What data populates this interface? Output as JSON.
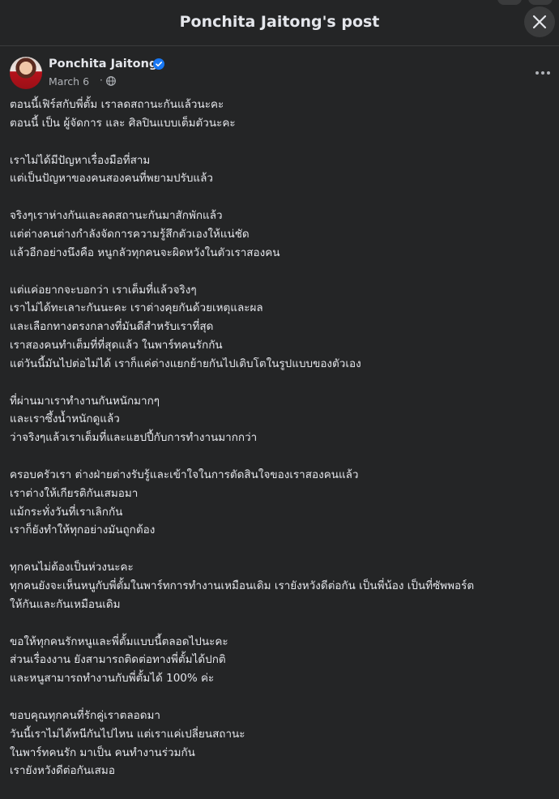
{
  "modal": {
    "title": "Ponchita Jaitong's post"
  },
  "post": {
    "author": "Ponchita Jaitong",
    "date": "March 6",
    "separator": "·",
    "verified_color": "#1877f2",
    "paragraphs": [
      [
        "ตอนนี้เฟิร์สกับพี่ตั้ม เราลดสถานะกันแล้วนะคะ",
        "ตอนนี้ เป็น ผู้จัดการ และ ศิลปินแบบเต็มตัวนะคะ"
      ],
      [
        "เราไม่ได้มีปัญหาเรื่องมือที่สาม",
        "แต่เป็นปัญหาของคนสองคนที่พยามปรับแล้ว"
      ],
      [
        "จริงๆเราห่างกันและลดสถานะกันมาสักพักแล้ว",
        "แต่ต่างคนต่างกำลังจัดการความรู้สึกตัวเองให้แน่ชัด",
        "แล้วอีกอย่างนึงคือ หนูกลัวทุกคนจะผิดหวังในตัวเราสองคน"
      ],
      [
        "แต่แค่อยากจะบอกว่า เราเต็มที่แล้วจริงๆ",
        "เราไม่ได้ทะเลาะกันนะคะ เราต่างคุยกันด้วยเหตุและผล",
        "และเลือกทางตรงกลางที่มันดีสำหรับเราที่สุด",
        "เราสองคนทำเต็มที่ที่สุดแล้ว ในพาร์ทคนรักกัน",
        "แต่วันนี้มันไปต่อไม่ได้ เราก็แค่ต่างแยกย้ายกันไปเติบโตในรูปแบบของตัวเอง"
      ],
      [
        "ที่ผ่านมาเราทำงานกันหนักมากๆ",
        "และเราซึ้งน้ำหนักดูแล้ว",
        "ว่าจริงๆแล้วเราเต็มที่และแฮปปี้กับการทำงานมากกว่า"
      ],
      [
        "ครอบครัวเรา ต่างฝ่ายต่างรับรู้และเข้าใจในการตัดสินใจของเราสองคนแล้ว",
        "เราต่างให้เกียรติกันเสมอมา",
        "แม้กระทั่งวันที่เราเลิกกัน",
        "เราก็ยังทำให้ทุกอย่างมันถูกต้อง"
      ],
      [
        "ทุกคนไม่ต้องเป็นห่วงนะคะ",
        "ทุกคนยังจะเห็นหนูกับพี่ตั้มในพาร์ทการทำงานเหมือนเดิม เรายังหวังดีต่อกัน เป็นพี่น้อง เป็นที่ซัพพอร์ต",
        "ให้กันและกันเหมือนเดิม"
      ],
      [
        "ขอให้ทุกคนรักหนูและพี่ตั้มแบบนี้ตลอดไปนะคะ",
        "ส่วนเรื่องงาน ยังสามารถติดต่อทางพี่ตั้มได้ปกติ",
        "และหนูสามารถทำงานกับพี่ตั้มได้ 100% ค่ะ"
      ],
      [
        "ขอบคุณทุกคนที่รักคู่เราตลอดมา",
        "วันนี้เราไม่ได้หนีกันไปไหน แต่เราแค่เปลี่ยนสถานะ",
        "ในพาร์ทคนรัก มาเป็น คนทำงานร่วมกัน",
        "เรายังหวังดีต่อกันเสมอ"
      ]
    ]
  }
}
